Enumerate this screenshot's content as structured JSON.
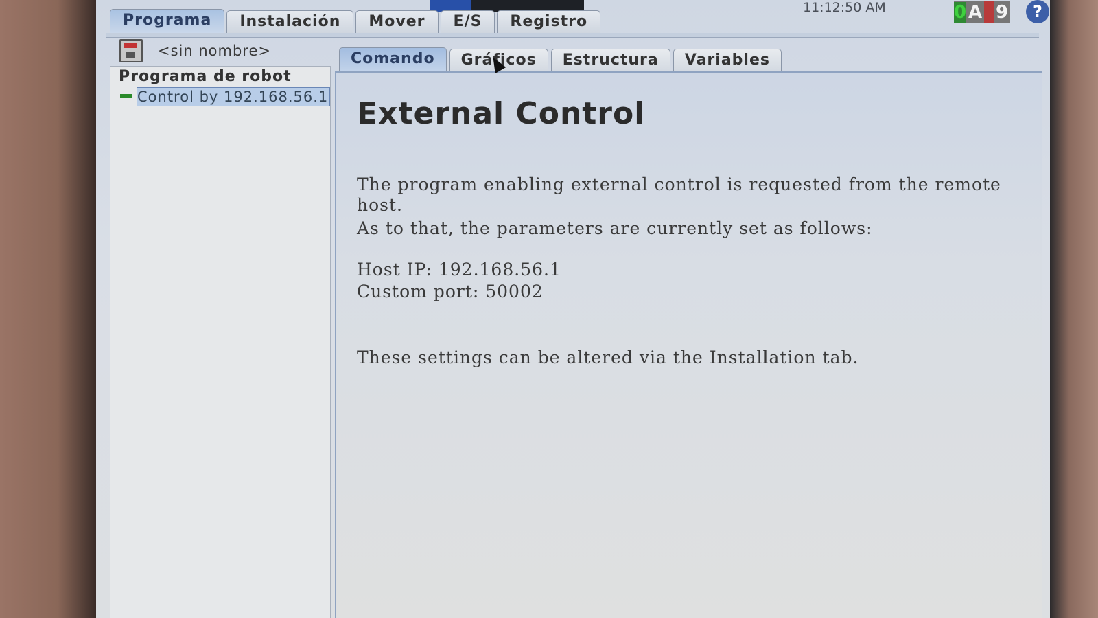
{
  "topbar": {
    "clock": "11:12:50 AM",
    "badge": {
      "left": "0",
      "mid": "A",
      "right": "9"
    },
    "help_symbol": "?"
  },
  "main_tabs": [
    "Programa",
    "Instalación",
    "Mover",
    "E/S",
    "Registro"
  ],
  "file": {
    "name": "<sin nombre>"
  },
  "tree": {
    "root": "Programa de robot",
    "item": "Control by 192.168.56.1"
  },
  "sub_tabs": [
    "Comando",
    "Gráficos",
    "Estructura",
    "Variables"
  ],
  "content": {
    "title": "External Control",
    "paragraph1": "The program enabling external control is requested from the remote host.",
    "paragraph2": "As to that, the parameters are currently set as follows:",
    "host_ip": "Host IP: 192.168.56.1",
    "custom_port": "Custom port: 50002",
    "footer": "These settings can be altered via the Installation tab."
  },
  "icons": {
    "save": "save-icon",
    "help": "help-icon",
    "cursor": "mouse-cursor-icon"
  },
  "colors": {
    "active_tab": "#a9c2e2",
    "selected_item": "#b8cde8",
    "status_green": "#2f8a33",
    "status_red": "#b83a3a"
  }
}
